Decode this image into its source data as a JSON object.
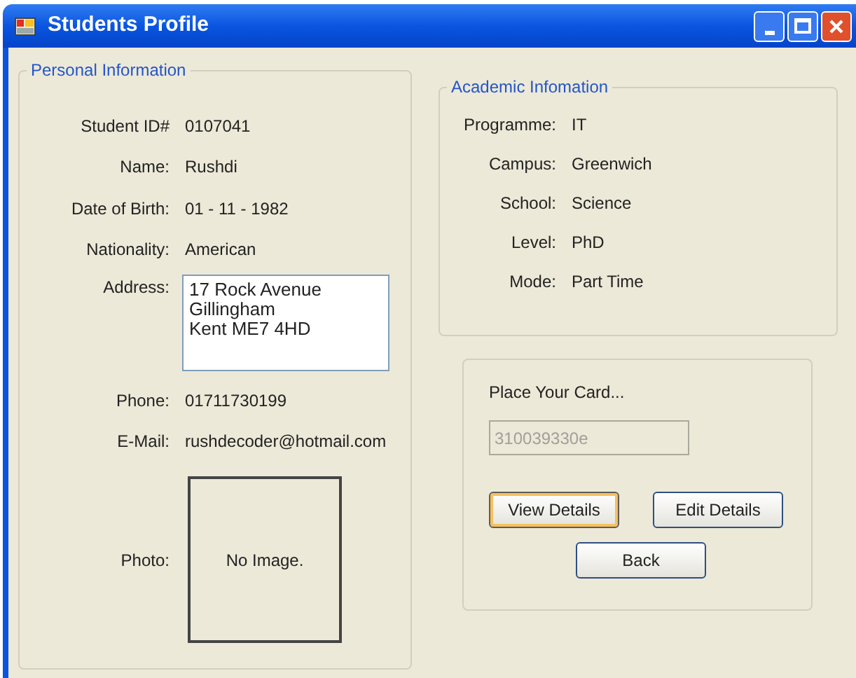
{
  "window": {
    "title": "Students Profile"
  },
  "personal_information": {
    "title": "Personal Information",
    "fields": [
      {
        "label": "Student ID#",
        "value": "0107041"
      },
      {
        "label": "Name:",
        "value": "Rushdi"
      },
      {
        "label": "Date of Birth:",
        "value": "01 - 11 - 1982"
      },
      {
        "label": "Nationality:",
        "value": "American"
      }
    ],
    "address": {
      "label": "Address:",
      "lines": [
        "17 Rock Avenue",
        "Gillingham",
        "Kent ME7 4HD"
      ]
    },
    "contact": [
      {
        "label": "Phone:",
        "value": "01711730199"
      },
      {
        "label": "E-Mail:",
        "value": "rushdecoder@hotmail.com"
      }
    ],
    "photo": {
      "label": "Photo:",
      "text": "No Image."
    }
  },
  "academic_information": {
    "title": "Academic Infomation",
    "fields": [
      {
        "label": "Programme:",
        "value": "IT"
      },
      {
        "label": "Campus:",
        "value": "Greenwich"
      },
      {
        "label": "School:",
        "value": "Science"
      },
      {
        "label": "Level:",
        "value": "PhD"
      },
      {
        "label": "Mode:",
        "value": "Part Time"
      }
    ]
  },
  "card": {
    "prompt": "Place Your Card...",
    "card_number": {
      "value": "310039330e",
      "disabled": true
    },
    "buttons": [
      {
        "label": "View Details",
        "focused": true
      },
      {
        "label": "Edit Details",
        "focused": false
      },
      {
        "label": "Back",
        "focused": false
      }
    ]
  }
}
